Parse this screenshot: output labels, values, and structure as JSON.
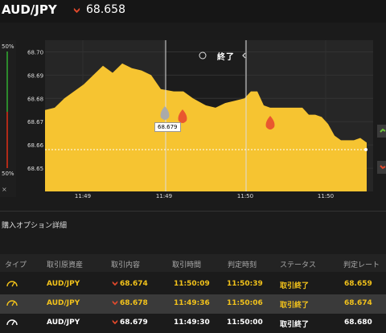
{
  "header": {
    "pair": "AUD/JPY",
    "rate": "68.658",
    "accent": "#f2c21b",
    "down_color": "#e0492c"
  },
  "chart": {
    "gauge": {
      "top_label": "50%",
      "bottom_label": "50%",
      "close": "×"
    },
    "close_label": "終了",
    "tooltip": "68.679",
    "y_ticks": [
      "68.70",
      "68.69",
      "68.68",
      "68.67",
      "68.66",
      "68.65"
    ],
    "x_ticks": [
      "11:49",
      "11:49",
      "11:50",
      "11:50"
    ]
  },
  "chart_data": {
    "type": "area",
    "ylim": [
      68.64,
      68.705
    ],
    "x": [
      0,
      3,
      6,
      9,
      12,
      15,
      18,
      21,
      24,
      27,
      30,
      33,
      36,
      40,
      43,
      46,
      50,
      53,
      56,
      59,
      62,
      64,
      66,
      68,
      70,
      72,
      74,
      76,
      78,
      80,
      82,
      84,
      86,
      88,
      90,
      92,
      94,
      96,
      98,
      100
    ],
    "values": [
      68.675,
      68.676,
      68.68,
      68.683,
      68.686,
      68.69,
      68.694,
      68.691,
      68.695,
      68.693,
      68.692,
      68.69,
      68.684,
      68.683,
      68.683,
      68.68,
      68.677,
      68.676,
      68.678,
      68.679,
      68.68,
      68.683,
      68.683,
      68.677,
      68.676,
      68.676,
      68.676,
      68.676,
      68.676,
      68.676,
      68.673,
      68.673,
      68.672,
      68.669,
      68.664,
      68.662,
      68.662,
      68.662,
      68.663,
      68.661
    ],
    "markers": [
      {
        "label": "68.679",
        "value": 68.679
      },
      {
        "value": 68.675
      },
      {
        "value": 68.67
      }
    ],
    "grid": true
  },
  "section": {
    "title": "購入オプション詳細"
  },
  "table": {
    "headers": [
      "タイプ",
      "取引原資産",
      "取引内容",
      "取引時間",
      "判定時刻",
      "ステータス",
      "判定レート"
    ],
    "rows": [
      {
        "asset": "AUD/JPY",
        "price": "68.674",
        "time": "11:50:09",
        "judge": "11:50:39",
        "status": "取引終了",
        "rate": "68.659"
      },
      {
        "asset": "AUD/JPY",
        "price": "68.678",
        "time": "11:49:36",
        "judge": "11:50:06",
        "status": "取引終了",
        "rate": "68.674"
      },
      {
        "asset": "AUD/JPY",
        "price": "68.679",
        "time": "11:49:30",
        "judge": "11:50:00",
        "status": "取引終了",
        "rate": "68.680"
      }
    ]
  }
}
